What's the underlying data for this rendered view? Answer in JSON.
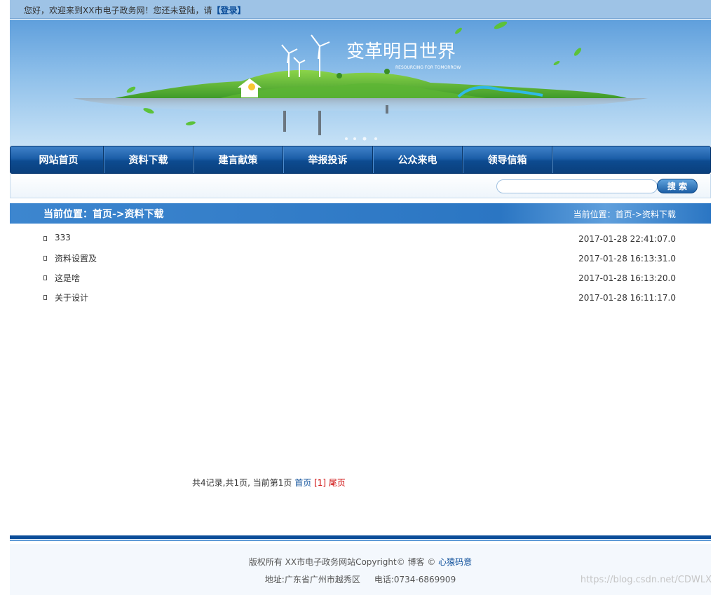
{
  "topbar": {
    "greeting": "您好，欢迎来到XX市电子政务网！您还未登陆，请",
    "login_label": "【登录】"
  },
  "banner": {
    "slogan": "变革明日世界",
    "slogan_sub": "RESOURCING FOR TOMORROW"
  },
  "nav": {
    "items": [
      {
        "label": "网站首页"
      },
      {
        "label": "资料下载"
      },
      {
        "label": "建言献策"
      },
      {
        "label": "举报投诉"
      },
      {
        "label": "公众来电"
      },
      {
        "label": "领导信箱"
      }
    ]
  },
  "search": {
    "placeholder": "",
    "button_label": "搜 索"
  },
  "location": {
    "title": "当前位置：首页->资料下载",
    "crumb": "当前位置：首页->资料下载"
  },
  "list": {
    "items": [
      {
        "title": "333",
        "time": "2017-01-28 22:41:07.0"
      },
      {
        "title": "资料设置及",
        "time": "2017-01-28 16:13:31.0"
      },
      {
        "title": "这是啥",
        "time": "2017-01-28 16:13:20.0"
      },
      {
        "title": "关于设计",
        "time": "2017-01-28 16:11:17.0"
      }
    ]
  },
  "pager": {
    "summary": "共4记录,共1页, 当前第1页",
    "first_label": "首页",
    "current_label": "[1]",
    "last_label": "尾页"
  },
  "footer": {
    "copyright_prefix": "版权所有 XX市电子政务网站Copyright© 博客 ©",
    "author": "心猿码意",
    "address": "地址:广东省广州市越秀区",
    "phone": "电话:0734-6869909"
  },
  "watermark": "https://blog.csdn.net/CDWLX",
  "colors": {
    "nav_blue": "#0d4b90",
    "location_blue": "#2b76c3",
    "topbar_blue": "#9ec3e6",
    "link_blue": "#0b4d99",
    "pager_red": "#cc0000"
  }
}
